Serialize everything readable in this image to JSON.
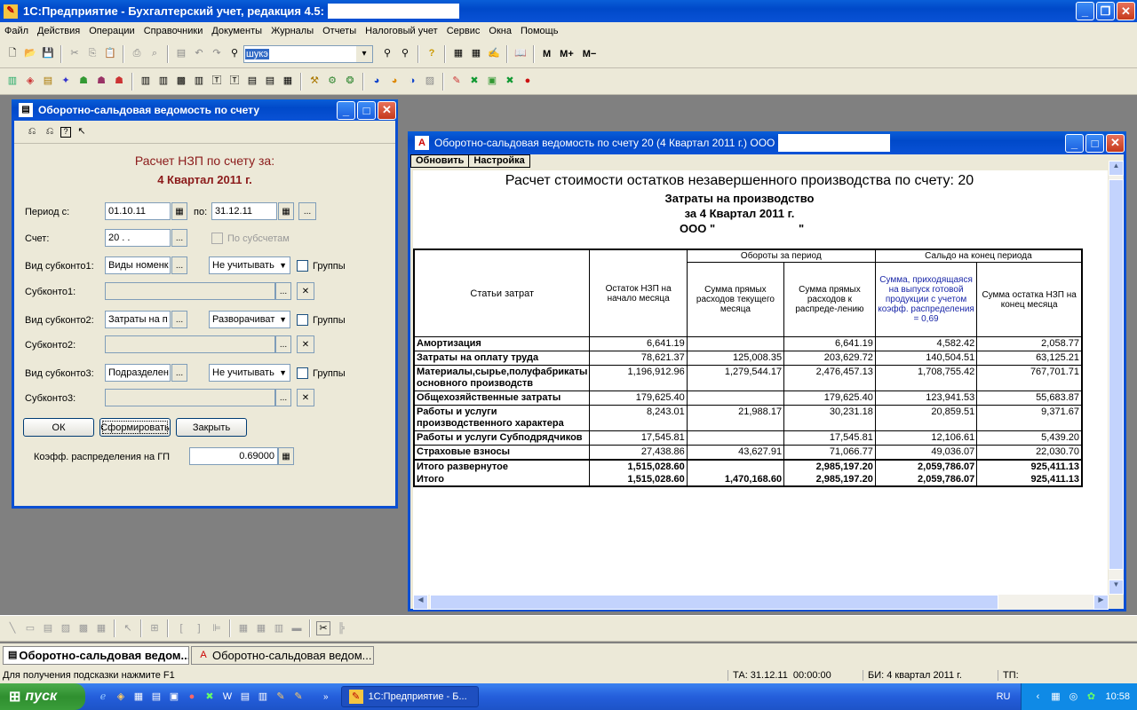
{
  "app": {
    "title": "1С:Предприятие - Бухгалтерский учет, редакция 4.5:"
  },
  "menu": [
    "Файл",
    "Действия",
    "Операции",
    "Справочники",
    "Документы",
    "Журналы",
    "Отчеты",
    "Налоговый учет",
    "Сервис",
    "Окна",
    "Помощь"
  ],
  "toolbar": {
    "search_value": "шукэ",
    "m": "M",
    "mplus": "M+",
    "mminus": "M−"
  },
  "dialog": {
    "title": "Оборотно-сальдовая ведомость по счету",
    "heading1": "Расчет НЗП по счету за:",
    "heading2": "4 Квартал 2011 г.",
    "period_from_label": "Период с:",
    "period_from": "01.10.11",
    "period_to_label": "по:",
    "period_to": "31.12.11",
    "account_label": "Счет:",
    "account": "20 .  .",
    "by_subaccounts": "По субсчетам",
    "sub1_type_label": "Вид субконто1:",
    "sub1_type": "Виды номенк",
    "sub1_mode": "Не учитывать",
    "groups": "Группы",
    "sub1_label": "Субконто1:",
    "sub2_type_label": "Вид субконто2:",
    "sub2_type": "Затраты на п",
    "sub2_mode": "Разворачиват",
    "sub2_label": "Субконто2:",
    "sub3_type_label": "Вид субконто3:",
    "sub3_type": "Подразделен",
    "sub3_mode": "Не учитывать",
    "sub3_label": "Субконто3:",
    "ok": "ОК",
    "form": "Сформировать",
    "close": "Закрыть",
    "coef_label": "Коэфф. распределения на ГП",
    "coef": "0.69000"
  },
  "report": {
    "title": "Оборотно-сальдовая ведомость по счету 20 (4 Квартал 2011 г.) ООО",
    "refresh": "Обновить",
    "settings": "Настройка",
    "h1": "Расчет стоимости остатков незавершенного производства по счету: 20",
    "h2": "Затраты на производство",
    "h3": "за 4 Квартал 2011 г.",
    "h4": "ООО \"                          \"",
    "col_articles": "Статьи затрат",
    "col_start": "Остаток НЗП на начало месяца",
    "grp_turnover": "Обороты за период",
    "col_direct": "Сумма прямых расходов текущего месяца",
    "col_alloc": "Сумма прямых расходов к распреде-лению",
    "grp_balance": "Сальдо на конец периода",
    "col_finished": "Сумма, приходящаяся на выпуск готовой продукции с учетом коэфф. распределения = 0,69",
    "col_end": "Сумма остатка НЗП на конец месяца",
    "rows": [
      {
        "name": "Амортизация",
        "start": "6,641.19",
        "direct": "",
        "alloc": "6,641.19",
        "fin": "4,582.42",
        "end": "2,058.77"
      },
      {
        "name": "Затраты на оплату труда",
        "start": "78,621.37",
        "direct": "125,008.35",
        "alloc": "203,629.72",
        "fin": "140,504.51",
        "end": "63,125.21"
      },
      {
        "name": "Материалы,сырье,полуфабрикаты основного производств",
        "start": "1,196,912.96",
        "direct": "1,279,544.17",
        "alloc": "2,476,457.13",
        "fin": "1,708,755.42",
        "end": "767,701.71"
      },
      {
        "name": "Общехозяйственные затраты",
        "start": "179,625.40",
        "direct": "",
        "alloc": "179,625.40",
        "fin": "123,941.53",
        "end": "55,683.87"
      },
      {
        "name": "Работы и услуги производственного характера",
        "start": "8,243.01",
        "direct": "21,988.17",
        "alloc": "30,231.18",
        "fin": "20,859.51",
        "end": "9,371.67"
      },
      {
        "name": "Работы и услуги Субподрядчиков",
        "start": "17,545.81",
        "direct": "",
        "alloc": "17,545.81",
        "fin": "12,106.61",
        "end": "5,439.20"
      },
      {
        "name": "Страховые взносы",
        "start": "27,438.86",
        "direct": "43,627.91",
        "alloc": "71,066.77",
        "fin": "49,036.07",
        "end": "22,030.70"
      }
    ],
    "total1": {
      "name": "Итого развернутое",
      "start": "1,515,028.60",
      "direct": "",
      "alloc": "2,985,197.20",
      "fin": "2,059,786.07",
      "end": "925,411.13"
    },
    "total2": {
      "name": "Итого",
      "start": "1,515,028.60",
      "direct": "1,470,168.60",
      "alloc": "2,985,197.20",
      "fin": "2,059,786.07",
      "end": "925,411.13"
    }
  },
  "wintabs": [
    "Оборотно-сальдовая ведом...",
    "Оборотно-сальдовая ведом..."
  ],
  "status": {
    "hint": "Для получения подсказки нажмите F1",
    "ta": "ТА: 31.12.11  00:00:00",
    "bi": "БИ: 4 квартал 2011 г.",
    "tp": "ТП:"
  },
  "taskbar": {
    "start": "пуск",
    "task": "1С:Предприятие - Б...",
    "lang": "RU",
    "time": "10:58"
  }
}
